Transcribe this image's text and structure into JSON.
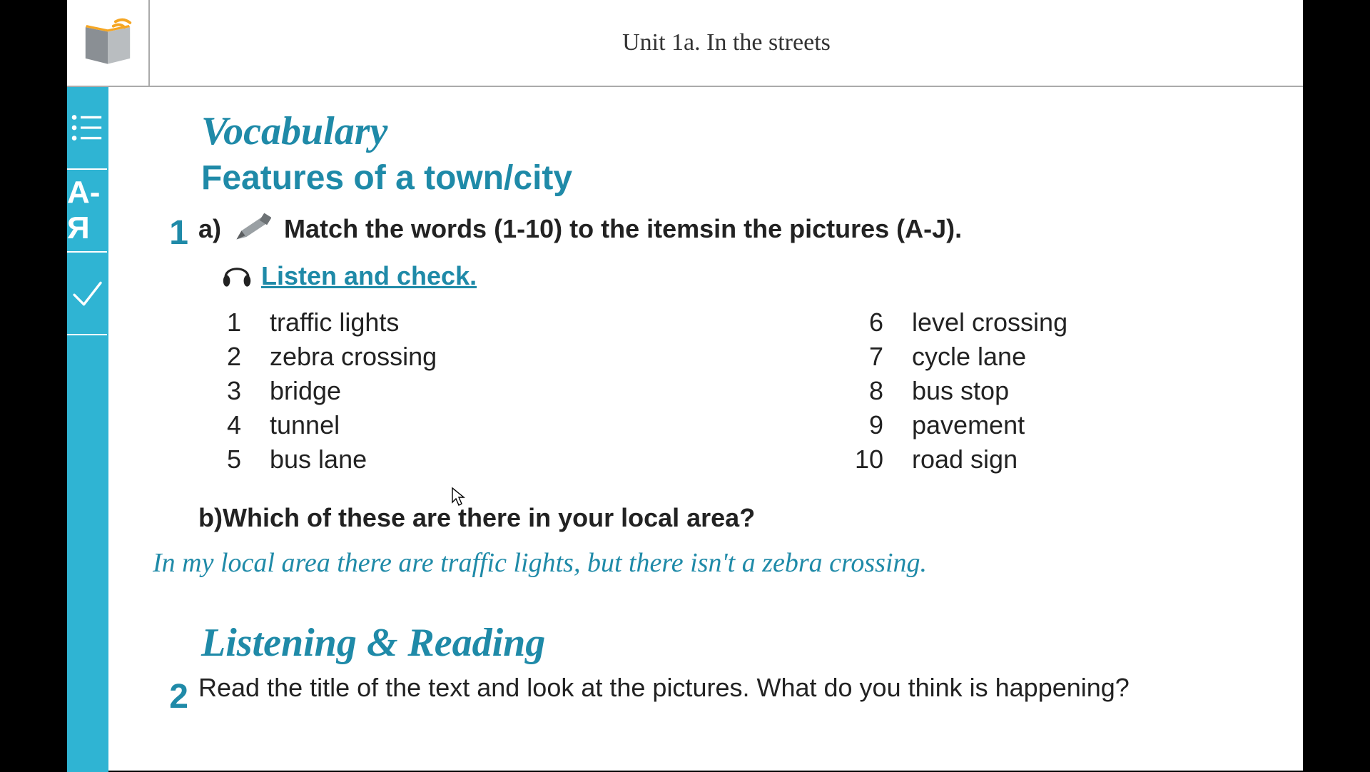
{
  "header": {
    "unit_title": "Unit 1a. In the streets"
  },
  "sidebar": {
    "items": [
      {
        "name": "toc-button",
        "kind": "icon",
        "icon": "list"
      },
      {
        "name": "glossary-button",
        "kind": "text",
        "label": "А-Я"
      },
      {
        "name": "check-button",
        "kind": "icon",
        "icon": "check"
      }
    ]
  },
  "content": {
    "section1_title": "Vocabulary",
    "section1_subtitle": "Features of a town/city",
    "exercise1": {
      "number": "1",
      "part_a_label": "a)",
      "part_a_instruction": "Match the words (1-10) to the itemsin the pictures (A-J).",
      "listen_label": " Listen and check.",
      "words_left": [
        {
          "n": "1",
          "w": "traffic lights"
        },
        {
          "n": "2",
          "w": "zebra crossing"
        },
        {
          "n": "3",
          "w": "bridge"
        },
        {
          "n": "4",
          "w": "tunnel"
        },
        {
          "n": "5",
          "w": "bus lane"
        }
      ],
      "words_right": [
        {
          "n": "6",
          "w": "level crossing"
        },
        {
          "n": "7",
          "w": "cycle lane"
        },
        {
          "n": "8",
          "w": "bus stop"
        },
        {
          "n": "9",
          "w": "pavement"
        },
        {
          "n": "10",
          "w": "road sign"
        }
      ],
      "part_b_label": "b)",
      "part_b_question": "Which of these are there in your local area?",
      "example": "In my local area there are traffic lights, but there isn't a zebra crossing."
    },
    "section2_title": "Listening & Reading",
    "exercise2": {
      "number": "2",
      "question": "Read the title of the text and look at the pictures. What do you think is happening?"
    }
  },
  "colors": {
    "accent": "#1f8aa8",
    "sidebar": "#2fb4d3"
  }
}
